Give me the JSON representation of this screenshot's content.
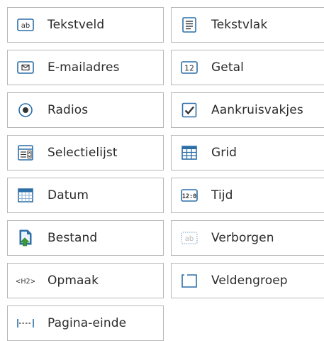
{
  "fields": [
    {
      "label": "Tekstveld",
      "icon": "textfield-icon"
    },
    {
      "label": "Tekstvlak",
      "icon": "textarea-icon"
    },
    {
      "label": "E-mailadres",
      "icon": "envelope-icon"
    },
    {
      "label": "Getal",
      "icon": "number-icon"
    },
    {
      "label": "Radios",
      "icon": "radio-icon"
    },
    {
      "label": "Aankruisvakjes",
      "icon": "checkbox-icon"
    },
    {
      "label": "Selectielijst",
      "icon": "select-list-icon"
    },
    {
      "label": "Grid",
      "icon": "grid-icon"
    },
    {
      "label": "Datum",
      "icon": "calendar-icon"
    },
    {
      "label": "Tijd",
      "icon": "time-icon"
    },
    {
      "label": "Bestand",
      "icon": "file-upload-icon"
    },
    {
      "label": "Verborgen",
      "icon": "hidden-field-icon"
    },
    {
      "label": "Opmaak",
      "icon": "markup-icon"
    },
    {
      "label": "Veldengroep",
      "icon": "fieldset-icon"
    },
    {
      "label": "Pagina-einde",
      "icon": "page-break-icon"
    }
  ],
  "icon_text": {
    "textfield": "ab",
    "number": "12",
    "time": "12:0",
    "hidden": "ab",
    "markup": "<H2>"
  },
  "colors": {
    "tile_border": "#b7b7b7",
    "icon_blue": "#2c6fa8",
    "icon_dark": "#333333",
    "upload_green": "#3a9a3a"
  }
}
